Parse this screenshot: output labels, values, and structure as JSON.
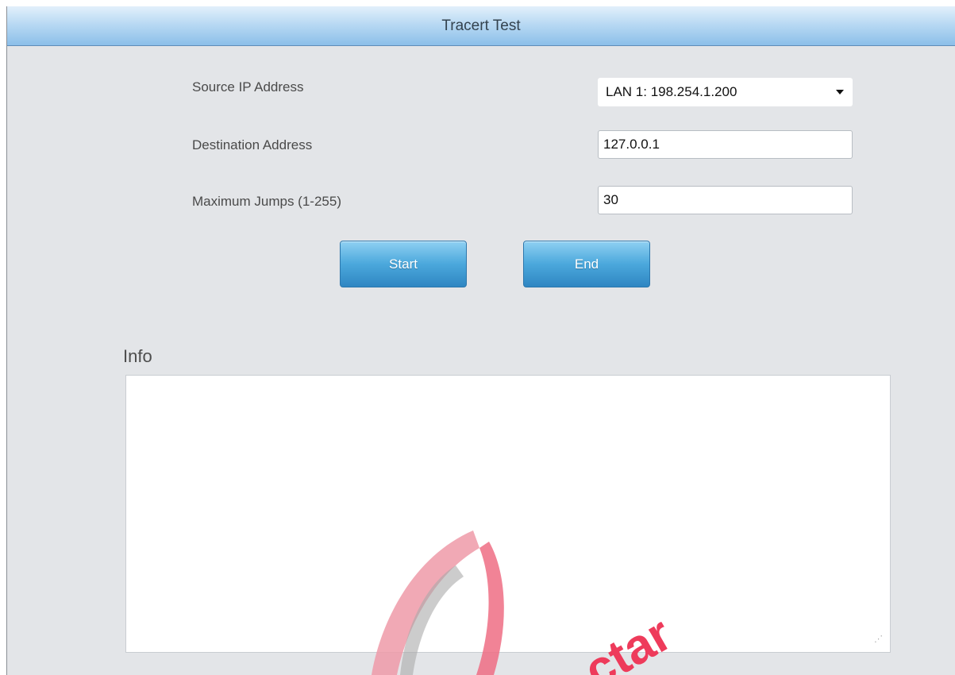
{
  "page": {
    "title": "Tracert Test"
  },
  "form": {
    "source_ip": {
      "label": "Source IP Address",
      "value": "LAN 1: 198.254.1.200"
    },
    "destination": {
      "label": "Destination Address",
      "value": "127.0.0.1"
    },
    "max_jumps": {
      "label": "Maximum Jumps (1-255)",
      "value": "30"
    }
  },
  "buttons": {
    "start": "Start",
    "end": "End"
  },
  "info": {
    "label": "Info",
    "content": ""
  },
  "watermark": {
    "text": "ctar",
    "color": "#ee3b5b"
  },
  "colors": {
    "accent": "#4ba8dc",
    "panel_bg": "#e3e5e8"
  }
}
